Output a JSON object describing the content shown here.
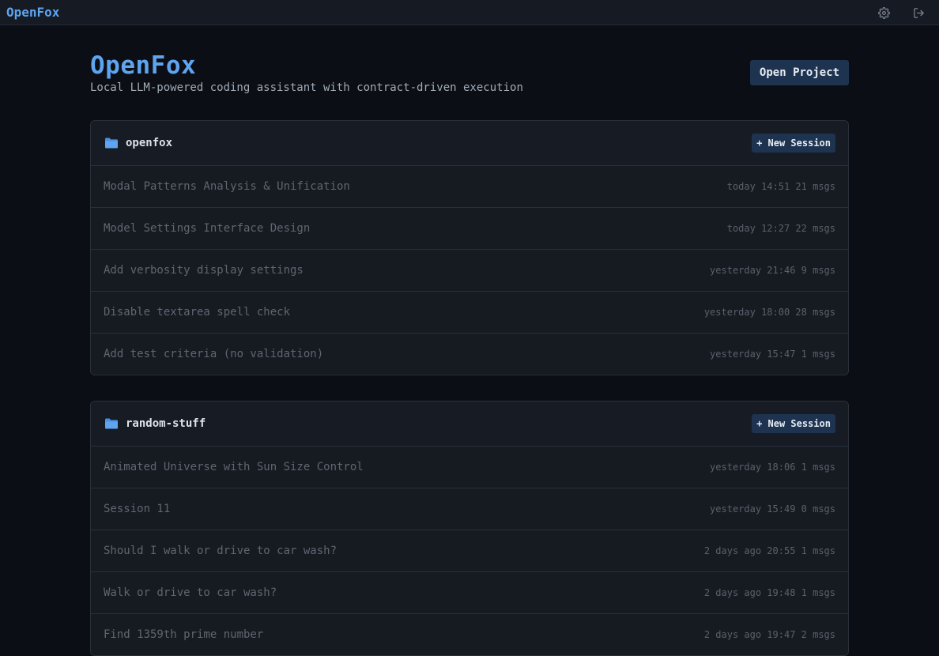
{
  "app": {
    "brand": "OpenFox"
  },
  "topbar": {
    "icons": [
      "gear-icon",
      "logout-icon"
    ]
  },
  "header": {
    "title": "OpenFox",
    "subtitle": "Local LLM-powered coding assistant with contract-driven execution",
    "open_project_label": "Open Project"
  },
  "colors": {
    "accent": "#5ea4ef",
    "background": "#0b0e14",
    "card": "#161b22",
    "button": "#1e3350"
  },
  "projects": [
    {
      "name": "openfox",
      "new_session_label": "+ New Session",
      "sessions": [
        {
          "title": "Modal Patterns Analysis & Unification",
          "meta": "today 14:51 21 msgs"
        },
        {
          "title": "Model Settings Interface Design",
          "meta": "today 12:27 22 msgs"
        },
        {
          "title": "Add verbosity display settings",
          "meta": "yesterday 21:46 9 msgs"
        },
        {
          "title": "Disable textarea spell check",
          "meta": "yesterday 18:00 28 msgs"
        },
        {
          "title": "Add test criteria (no validation)",
          "meta": "yesterday 15:47 1 msgs"
        }
      ]
    },
    {
      "name": "random-stuff",
      "new_session_label": "+ New Session",
      "sessions": [
        {
          "title": "Animated Universe with Sun Size Control",
          "meta": "yesterday 18:06 1 msgs"
        },
        {
          "title": "Session 11",
          "meta": "yesterday 15:49 0 msgs"
        },
        {
          "title": "Should I walk or drive to car wash?",
          "meta": "2 days ago 20:55 1 msgs"
        },
        {
          "title": "Walk or drive to car wash?",
          "meta": "2 days ago 19:48 1 msgs"
        },
        {
          "title": "Find 1359th prime number",
          "meta": "2 days ago 19:47 2 msgs"
        }
      ]
    }
  ]
}
